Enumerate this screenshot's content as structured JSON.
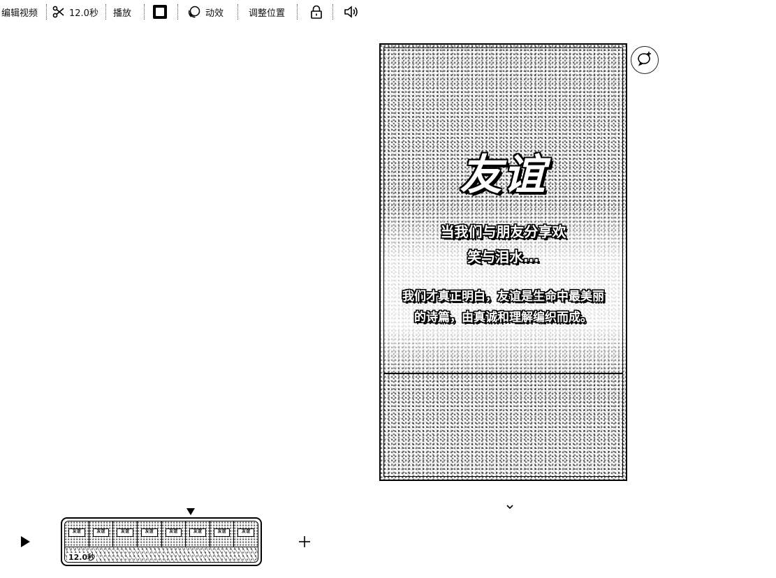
{
  "toolbar": {
    "edit_video": "编辑视频",
    "duration": "12.0秒",
    "play": "播放",
    "animation": "动效",
    "adjust_position": "调整位置",
    "icons": [
      "scissors-icon",
      "swatch-icon",
      "animation-icon",
      "lock-icon",
      "volume-icon"
    ]
  },
  "preview": {
    "title": "友谊",
    "lines": [
      "当我们与朋友分享欢",
      "笑与泪水...",
      "我们才真正明白，友谊是生命中最美丽",
      "的诗篇，由真诚和理解编织而成。"
    ]
  },
  "timeline": {
    "clip_duration": "12.0秒",
    "thumb_label": "友谊",
    "thumb_count": 8
  },
  "colors": {
    "ink": "#000000",
    "background": "#ffffff"
  }
}
